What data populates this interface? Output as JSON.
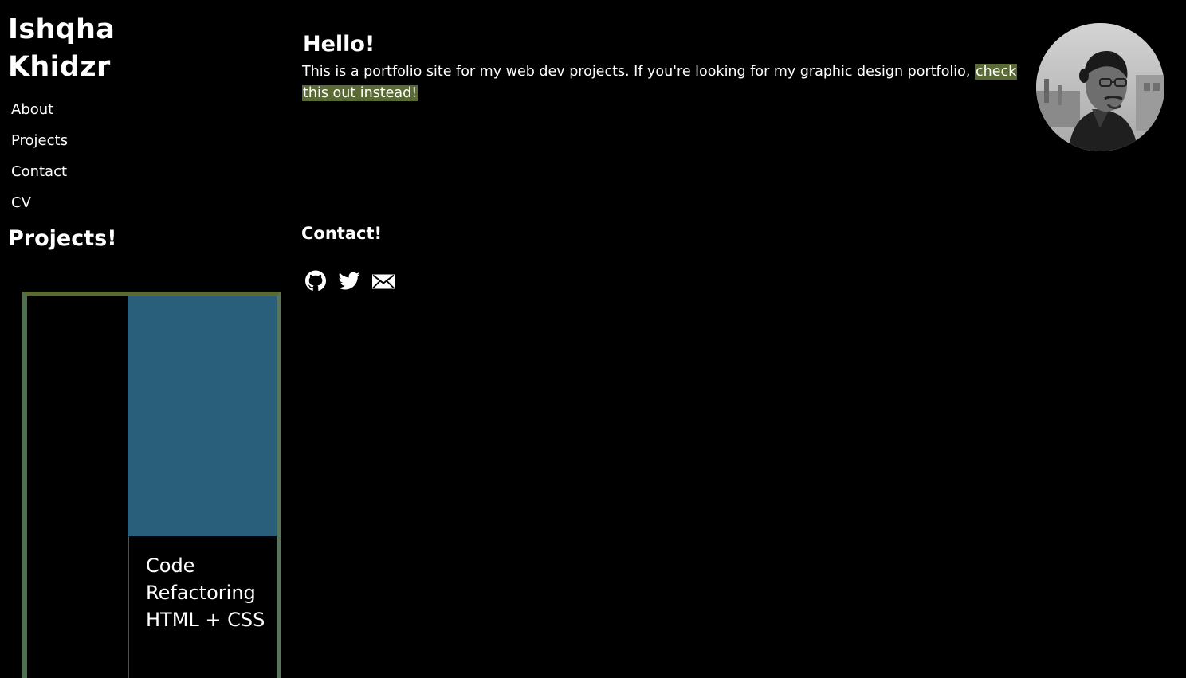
{
  "sidebar": {
    "title_line1": "Ishqha",
    "title_line2": "Khidzr",
    "nav": [
      {
        "label": "About"
      },
      {
        "label": "Projects"
      },
      {
        "label": "Contact"
      },
      {
        "label": "CV"
      }
    ],
    "projects_heading": "Projects!"
  },
  "project_card": {
    "title_line1": "Code",
    "title_line2": "Refactoring",
    "title_line3": "HTML + CSS",
    "image_color": "#2a5f7c",
    "border_color": "#5a6a34"
  },
  "main": {
    "hello_heading": "Hello!",
    "intro_text": "This is a portfolio site for my web dev projects. If you're looking for my graphic design portfolio, ",
    "intro_link_part1": "check",
    "intro_link_part2": "this out instead!",
    "link_highlight_color": "#5a6a34"
  },
  "contact": {
    "heading": "Contact!",
    "icons": [
      "github-icon",
      "twitter-icon",
      "mail-icon"
    ]
  }
}
